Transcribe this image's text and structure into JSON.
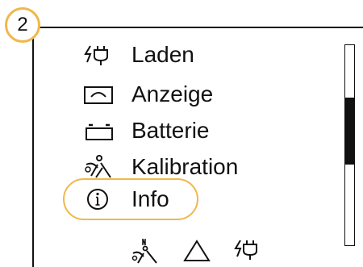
{
  "step": {
    "number": "2"
  },
  "menu": {
    "items": [
      {
        "label": "Laden",
        "icon": "charge-plug-icon"
      },
      {
        "label": "Anzeige",
        "icon": "display-icon"
      },
      {
        "label": "Batterie",
        "icon": "battery-icon"
      },
      {
        "label": "Kalibration",
        "icon": "calibration-icon"
      },
      {
        "label": "Info",
        "icon": "info-icon"
      }
    ],
    "selected_label": "Info"
  },
  "scrollbar": {
    "position_fraction": 0.26,
    "thumb_fraction": 0.33
  },
  "bottom_icons": [
    "calibration-north-icon",
    "warning-triangle-icon",
    "charge-plug-icon"
  ],
  "colors": {
    "highlight": "#f0b84a",
    "foreground": "#111111",
    "background": "#ffffff"
  }
}
